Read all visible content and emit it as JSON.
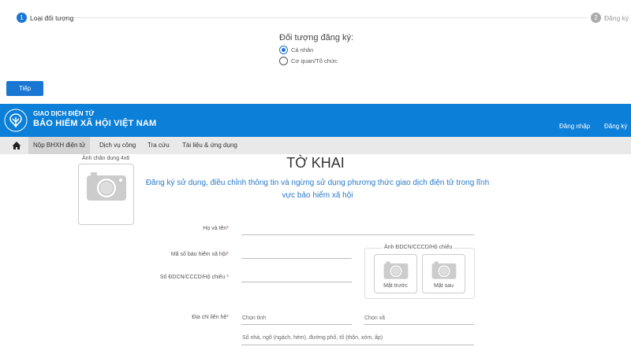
{
  "stepper": {
    "steps": [
      {
        "number": "1",
        "label": "Loại đối tượng",
        "active": true
      },
      {
        "number": "2",
        "label": "Đăng ký",
        "active": false
      }
    ]
  },
  "subject": {
    "title": "Đối tượng đăng ký:",
    "options": [
      {
        "label": "Cá nhân",
        "selected": true
      },
      {
        "label": "Cơ quan/Tổ chức",
        "selected": false
      }
    ]
  },
  "next_button": "Tiếp",
  "header": {
    "line1": "GIAO DỊCH ĐIỆN TỬ",
    "line2": "BẢO HIỂM XÃ HỘI VIỆT NAM",
    "login": "Đăng nhập",
    "register": "Đăng ký",
    "color": "#0c7fd8"
  },
  "nav": {
    "items": [
      "Nộp BHXH điện tử",
      "Dịch vụ công",
      "Tra cứu",
      "Tài liệu & ứng dụng"
    ],
    "active": "Nộp BHXH điện tử"
  },
  "form": {
    "portrait_label": "Ảnh chân dung 4x6",
    "title": "TỜ KHAI",
    "subtitle": "Đăng ký sử dụng, điều chỉnh thông tin và ngừng sử dụng phương thức giao dịch điện tử trong lĩnh vực bảo hiểm xã hội",
    "fields": {
      "name": "Họ và tên",
      "ssn": "Mã số bảo hiểm xã hội",
      "id": "Số ĐDCN/CCCD/Hộ chiếu",
      "address": "Địa chỉ liên hệ"
    },
    "required_mark": "*",
    "id_photo": {
      "legend": "Ảnh ĐDCN/CCCD/Hộ chiếu",
      "front": "Mặt trước",
      "back": "Mặt sau"
    },
    "placeholders": {
      "province": "Chọn tỉnh",
      "commune": "Chọn xã",
      "street": "Số nhà, ngõ (ngách, hẻm), đường phố, tổ (thôn, xóm, ấp)"
    }
  }
}
